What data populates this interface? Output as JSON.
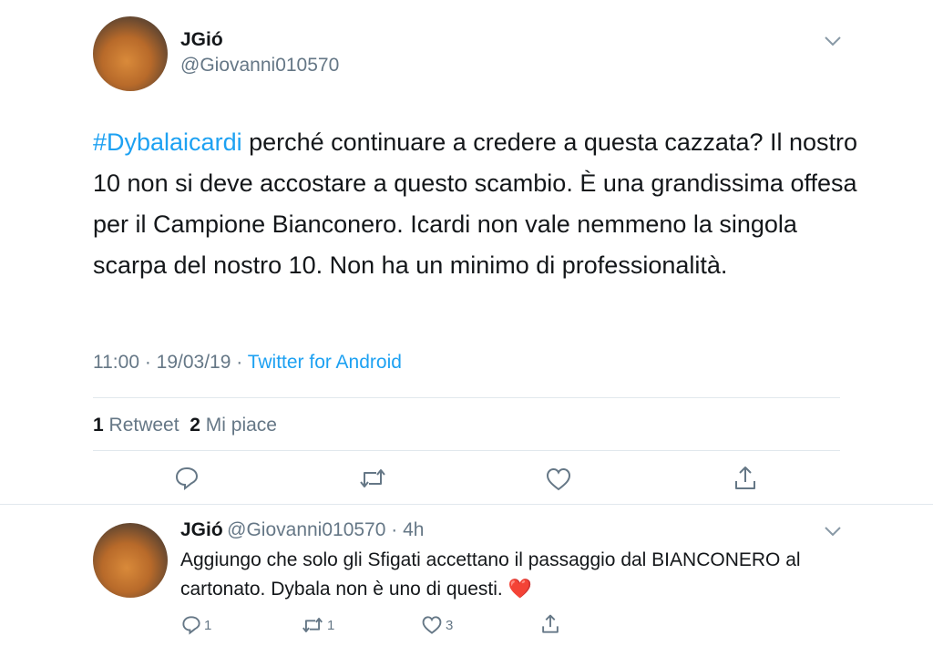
{
  "tweet": {
    "author_name": "JGió",
    "author_handle": "@Giovanni010570",
    "hashtag": "#Dybalaicardi",
    "text": "perché continuare a credere a questa cazzata? Il nostro 10 non si deve accostare a questo scambio. È una grandissima offesa per il Campione Bianconero. Icardi non vale nemmeno la singola scarpa del nostro 10. Non ha un minimo di professionalità.",
    "timestamp": "11:00 · 19/03/19 · ",
    "source": "Twitter for Android",
    "retweet_count": "1",
    "retweet_label": "Retweet",
    "like_count": "2",
    "like_label": "Mi piace"
  },
  "reply": {
    "author_name": "JGió",
    "author_handle_time": "@Giovanni010570 · 4h",
    "text": "Aggiungo che solo gli Sfigati accettano il passaggio dal BIANCONERO al cartonato. Dybala non è uno di questi.",
    "emoji": "❤️",
    "reply_count": "1",
    "retweet_count": "1",
    "like_count": "3"
  },
  "icons": [
    "chevron-down-icon",
    "reply-icon",
    "retweet-icon",
    "like-icon",
    "share-icon"
  ],
  "colors": {
    "accent": "#1da1f2",
    "secondary_text": "#657786",
    "divider": "#e1e8ed",
    "heart": "#e0245e"
  }
}
